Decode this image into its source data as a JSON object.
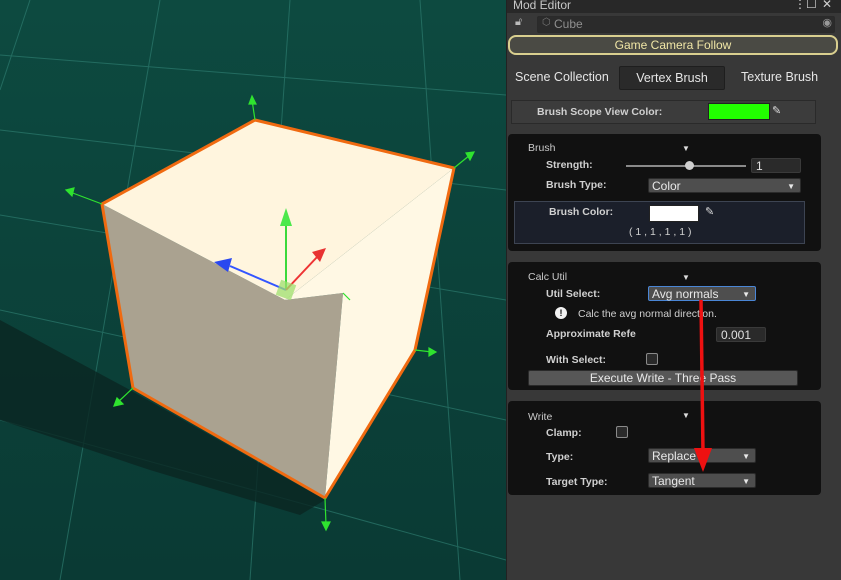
{
  "window": {
    "title": "Mod Editor",
    "menu_icon": "⋮",
    "maximize_icon": "☐",
    "close_icon": "✕"
  },
  "object": {
    "name": "Cube"
  },
  "game_camera_follow": "Game Camera Follow",
  "tabs": [
    {
      "label": "Scene Collection"
    },
    {
      "label": "Vertex Brush"
    },
    {
      "label": "Texture Brush"
    }
  ],
  "brush_scope_view_color": {
    "label": "Brush Scope View Color:",
    "color": "#22ff00"
  },
  "brush": {
    "title": "Brush",
    "strength_label": "Strength:",
    "strength_value": "1",
    "strength_fraction": 0.53,
    "type_label": "Brush Type:",
    "type_value": "Color",
    "color_label": "Brush Color:",
    "color": "#ffffff",
    "color_readout": "( 1 , 1 , 1 , 1 )"
  },
  "calc_util": {
    "title": "Calc Util",
    "util_select_label": "Util Select:",
    "util_select_value": "Avg normals",
    "info_text": "Calc the avg normal direction.",
    "approx_label": "Approximate Refe",
    "approx_value": "0.001",
    "with_select_label": "With Select:",
    "execute_label": "Execute Write - Three Pass"
  },
  "write": {
    "title": "Write",
    "clamp_label": "Clamp:",
    "type_label": "Type:",
    "type_value": "Replace",
    "target_type_label": "Target Type:",
    "target_type_value": "Tangent"
  },
  "colors": {
    "accent_yellow": "#d9cf8f",
    "selection_orange": "#f06a10",
    "annotation_red": "#ee1111",
    "ground": "#0f4a40"
  }
}
